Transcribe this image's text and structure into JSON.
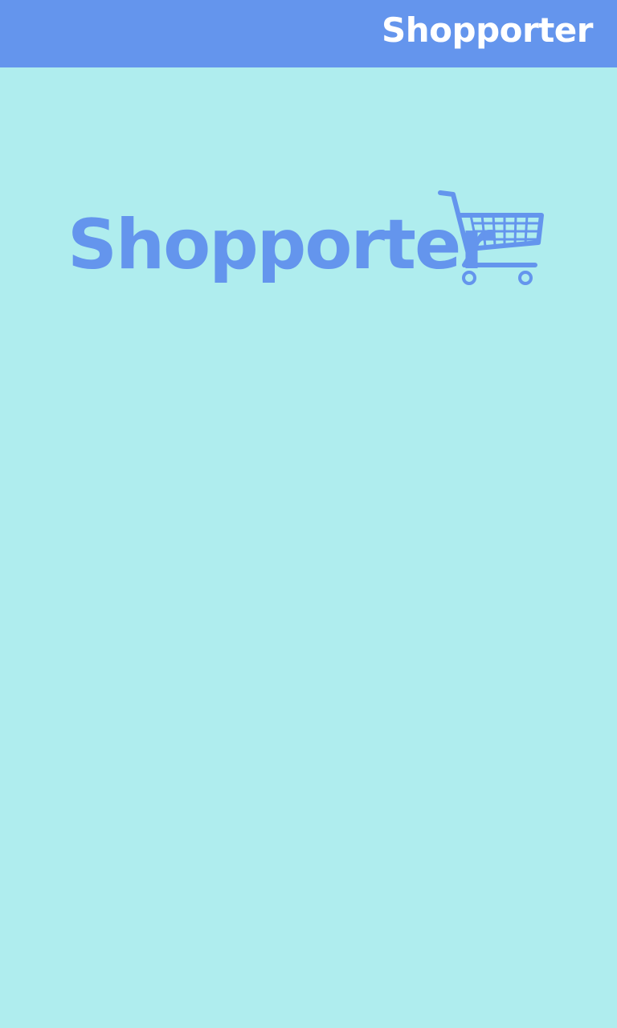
{
  "app_bar": {
    "title": "Shopporter"
  },
  "logo": {
    "wordmark": "Shopporter",
    "icon": "shopping-cart-icon"
  },
  "colors": {
    "app_bar_background": "#6495ED",
    "app_bar_text": "#FFFFFF",
    "page_background": "#AFEDEE",
    "logo": "#6495ED"
  }
}
